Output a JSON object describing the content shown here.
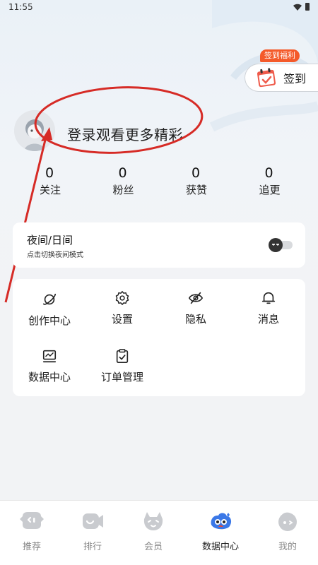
{
  "status_bar": {
    "time": "11:55"
  },
  "signin": {
    "badge": "签到福利",
    "label": "签到"
  },
  "profile": {
    "login_prompt": "登录观看更多精彩",
    "stats": [
      {
        "value": "0",
        "label": "关注"
      },
      {
        "value": "0",
        "label": "粉丝"
      },
      {
        "value": "0",
        "label": "获赞"
      },
      {
        "value": "0",
        "label": "追更"
      }
    ]
  },
  "night_mode": {
    "title": "夜间/日间",
    "subtitle": "点击切换夜间模式",
    "enabled": false
  },
  "menu": {
    "items": [
      {
        "label": "创作中心",
        "icon": "planet-icon"
      },
      {
        "label": "设置",
        "icon": "gear-icon"
      },
      {
        "label": "隐私",
        "icon": "eye-off-icon"
      },
      {
        "label": "消息",
        "icon": "bell-icon"
      },
      {
        "label": "数据中心",
        "icon": "chart-icon"
      },
      {
        "label": "订单管理",
        "icon": "clipboard-icon"
      }
    ]
  },
  "bottom_nav": {
    "items": [
      {
        "label": "推荐",
        "icon": "recommend-icon"
      },
      {
        "label": "排行",
        "icon": "ranking-icon"
      },
      {
        "label": "会员",
        "icon": "vip-icon"
      },
      {
        "label": "数据中心",
        "icon": "data-center-mascot-icon",
        "active": true
      },
      {
        "label": "我的",
        "icon": "mine-icon"
      }
    ]
  },
  "colors": {
    "accent": "#f45a2a",
    "annotation": "#d62b26",
    "nav_inactive": "#c9cbcf",
    "active_blue": "#3b78e7"
  }
}
